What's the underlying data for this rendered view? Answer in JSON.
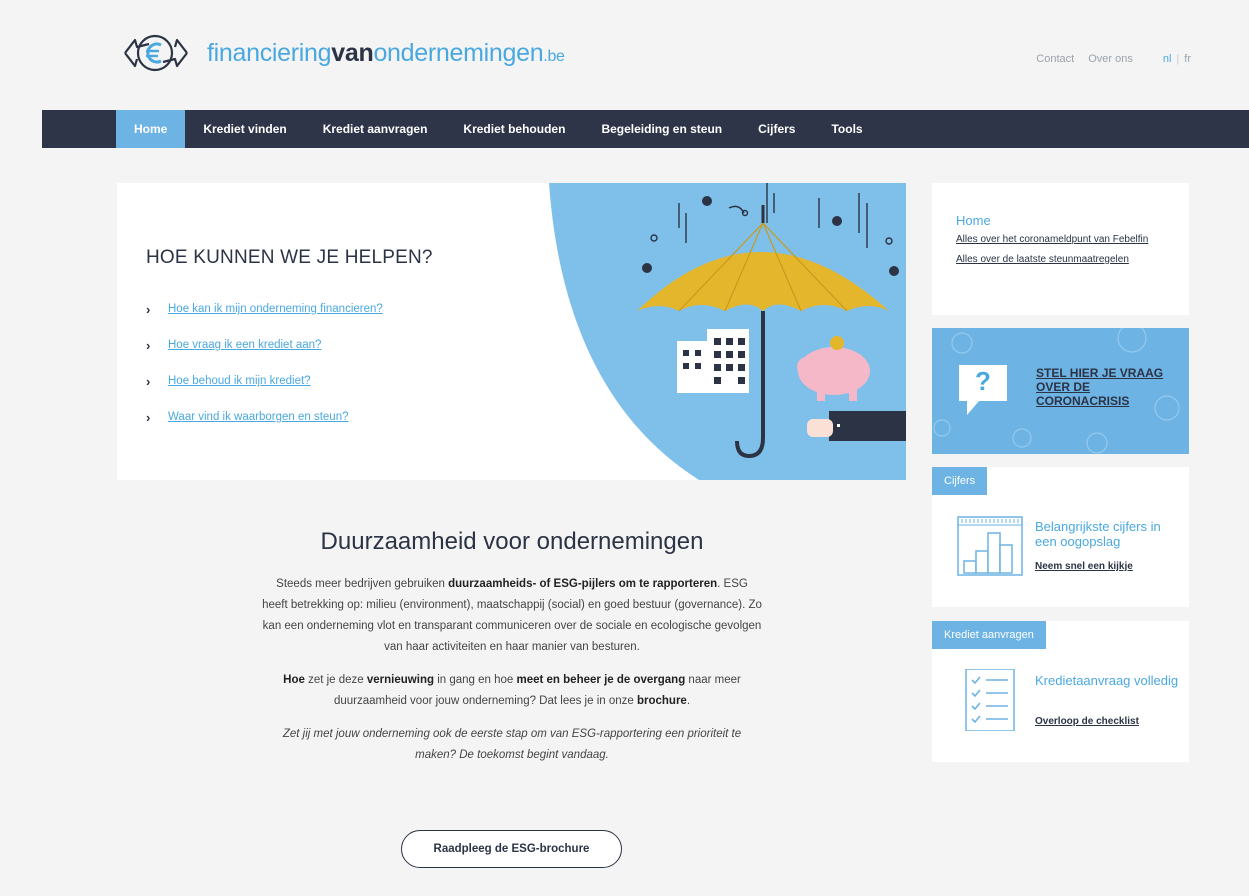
{
  "header": {
    "logo": {
      "part1": "financiering",
      "part2": "van",
      "part3": "ondernemingen",
      "part4": ".be"
    },
    "links": {
      "contact": "Contact",
      "about": "Over ons"
    },
    "lang": {
      "nl": "nl",
      "sep": "|",
      "fr": "fr"
    }
  },
  "nav": {
    "items": [
      {
        "label": "Home"
      },
      {
        "label": "Krediet vinden"
      },
      {
        "label": "Krediet aanvragen"
      },
      {
        "label": "Krediet behouden"
      },
      {
        "label": "Begeleiding en steun"
      },
      {
        "label": "Cijfers"
      },
      {
        "label": "Tools"
      }
    ]
  },
  "hero": {
    "heading": "HOE KUNNEN WE JE HELPEN?",
    "links": [
      {
        "label": "Hoe kan ik mijn onderneming financieren?"
      },
      {
        "label": "Hoe vraag ik een krediet aan?"
      },
      {
        "label": "Hoe behoud ik mijn krediet?"
      },
      {
        "label": "Waar vind ik waarborgen en steun?"
      }
    ]
  },
  "sidebar": {
    "home": {
      "title": "Home",
      "links": [
        {
          "label": "Alles over het coronameldpunt van Febelfin"
        },
        {
          "label": "Alles over de laatste steunmaatregelen"
        }
      ]
    },
    "corona": {
      "label": "STEL HIER JE VRAAG OVER DE CORONACRISIS",
      "q": "?"
    },
    "cijfers": {
      "tag": "Cijfers",
      "heading": "Belangrijkste cijfers in een oogopslag",
      "link": "Neem snel een kijkje"
    },
    "krediet": {
      "tag": "Krediet aanvragen",
      "heading": "Kredietaanvraag volledig",
      "link": "Overloop de checklist"
    }
  },
  "main": {
    "title": "Duurzaamheid voor ondernemingen",
    "p1": {
      "a": "Steeds meer bedrijven gebruiken ",
      "b": "duurzaamheids- of ESG-pijlers om te rapporteren",
      "c": ". ESG heeft betrekking op: milieu (environment), maatschappij (social) en goed bestuur (governance). Zo kan een onderneming vlot en transparant communiceren over de sociale en ecologische gevolgen van haar activiteiten en haar manier van besturen."
    },
    "p2": {
      "a": "Hoe",
      "b": " zet je deze ",
      "c": "vernieuwing",
      "d": " in gang en hoe ",
      "e": "meet en beheer je de overgang",
      "f": " naar meer duurzaamheid voor jouw onderneming? Dat lees je in onze ",
      "g": "brochure",
      "h": "."
    },
    "p3": "Zet jij met jouw onderneming ook de eerste stap om van ESG-rapportering een prioriteit te maken? De toekomst begint vandaag.",
    "button": "Raadpleeg de ESG-brochure"
  },
  "colors": {
    "accent": "#4aa8e0",
    "nav": "#2e3549",
    "navActive": "#6db3e4",
    "umbrella": "#e4b62c"
  }
}
